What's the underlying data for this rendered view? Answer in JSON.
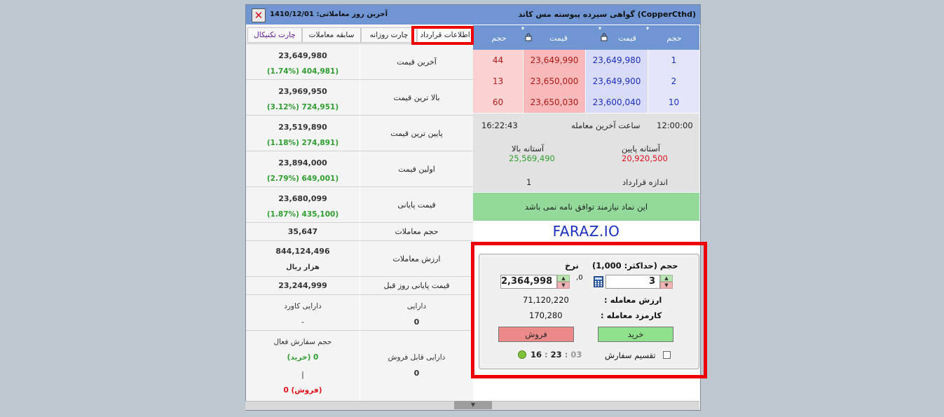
{
  "window": {
    "title": "(CopperCthd) گواهی سپرده پیوسته مس کاتد",
    "last_trade_day_label": "آخرین روز معاملاتی: 1410/12/01",
    "close_glyph": "✕"
  },
  "tabs": [
    {
      "label": "اطلاعات قرارداد",
      "active": true
    },
    {
      "label": "چارت روزانه",
      "active": false
    },
    {
      "label": "سابقه معاملات",
      "active": false
    },
    {
      "label": "چارت تکنیکال",
      "active": false
    }
  ],
  "info": {
    "last_price": {
      "label": "آخرین قیمت",
      "value": "23,649,980",
      "change": "(1.74%) 404,981)"
    },
    "high_price": {
      "label": "بالا ترین قیمت",
      "value": "23,969,950",
      "change": "(3.12%) 724,951)"
    },
    "low_price": {
      "label": "پایین ترین قیمت",
      "value": "23,519,890",
      "change": "(1.18%) 274,891)"
    },
    "first_price": {
      "label": "اولین قیمت",
      "value": "23,894,000",
      "change": "(2.79%) 649,001)"
    },
    "closing_price": {
      "label": "قیمت پایانی",
      "value": "23,680,099",
      "change": "(1.87%) 435,100)"
    },
    "trade_volume": {
      "label": "حجم معاملات",
      "value": "35,647"
    },
    "trade_value": {
      "label": "ارزش معاملات",
      "value": "844,124,496",
      "unit": "هزار ریال"
    },
    "prev_close": {
      "label": "قیمت پایانی روز قبل",
      "value": "23,244,999"
    },
    "covered_assets": {
      "label": "دارایی کاورد",
      "value": "-"
    },
    "assets": {
      "label": "دارایی",
      "value": "0"
    },
    "active_order_volume": {
      "label": "حجم سفارش فعال",
      "buy": "(خرید) 0",
      "sep": "|",
      "sell": "0 (فروش)"
    },
    "sellable_assets": {
      "label": "دارایی قابل فروش",
      "value": "0"
    }
  },
  "orderbook": {
    "headers": {
      "buy_volume": "حجم",
      "buy_price": "قیمت",
      "sell_price": "قیمت",
      "sell_volume": "حجم"
    },
    "rows": [
      {
        "buy_volume": "1",
        "buy_price": "23,649,980",
        "sell_price": "23,649,990",
        "sell_volume": "44"
      },
      {
        "buy_volume": "2",
        "buy_price": "23,649,900",
        "sell_price": "23,650,000",
        "sell_volume": "13"
      },
      {
        "buy_volume": "10",
        "buy_price": "23,600,040",
        "sell_price": "23,650,030",
        "sell_volume": "60"
      }
    ]
  },
  "market": {
    "time": "12:00:00",
    "last_trade_time_label": "ساعت آخرین معامله",
    "last_trade_time": "16:22:43",
    "lower_threshold_label": "آستانه پایین",
    "lower_threshold": "20,920,500",
    "upper_threshold_label": "آستانه بالا",
    "upper_threshold": "25,569,490",
    "contract_size_label": "اندازه قرارداد",
    "contract_size": "1",
    "notice": "این نماد نیازمند توافق نامه نمی باشد",
    "brand": "FARAZ.IO"
  },
  "order": {
    "volume_label": "حجم (حداکثر: 1,000)",
    "price_label": "نرخ",
    "volume": "3",
    "price": "2,364,998",
    "price_prefix": "0,",
    "trade_value_label": "ارزش معامله :",
    "trade_value": "71,120,220",
    "fee_label": "کارمزد معامله :",
    "fee": "170,280",
    "buy_label": "خرید",
    "sell_label": "فروش",
    "split_order_label": "تقسیم سفارش",
    "clock": {
      "h": "16",
      "m": "23",
      "s": "03",
      "sep": ":"
    }
  },
  "colors": {
    "header_blue": "#6f96d3",
    "buy_cell": "#d9dcf8",
    "sell_cell": "#f7b9b9",
    "positive_green": "#2e9e2e",
    "negative_red": "#e0101a",
    "highlight_red": "#ee0000"
  }
}
